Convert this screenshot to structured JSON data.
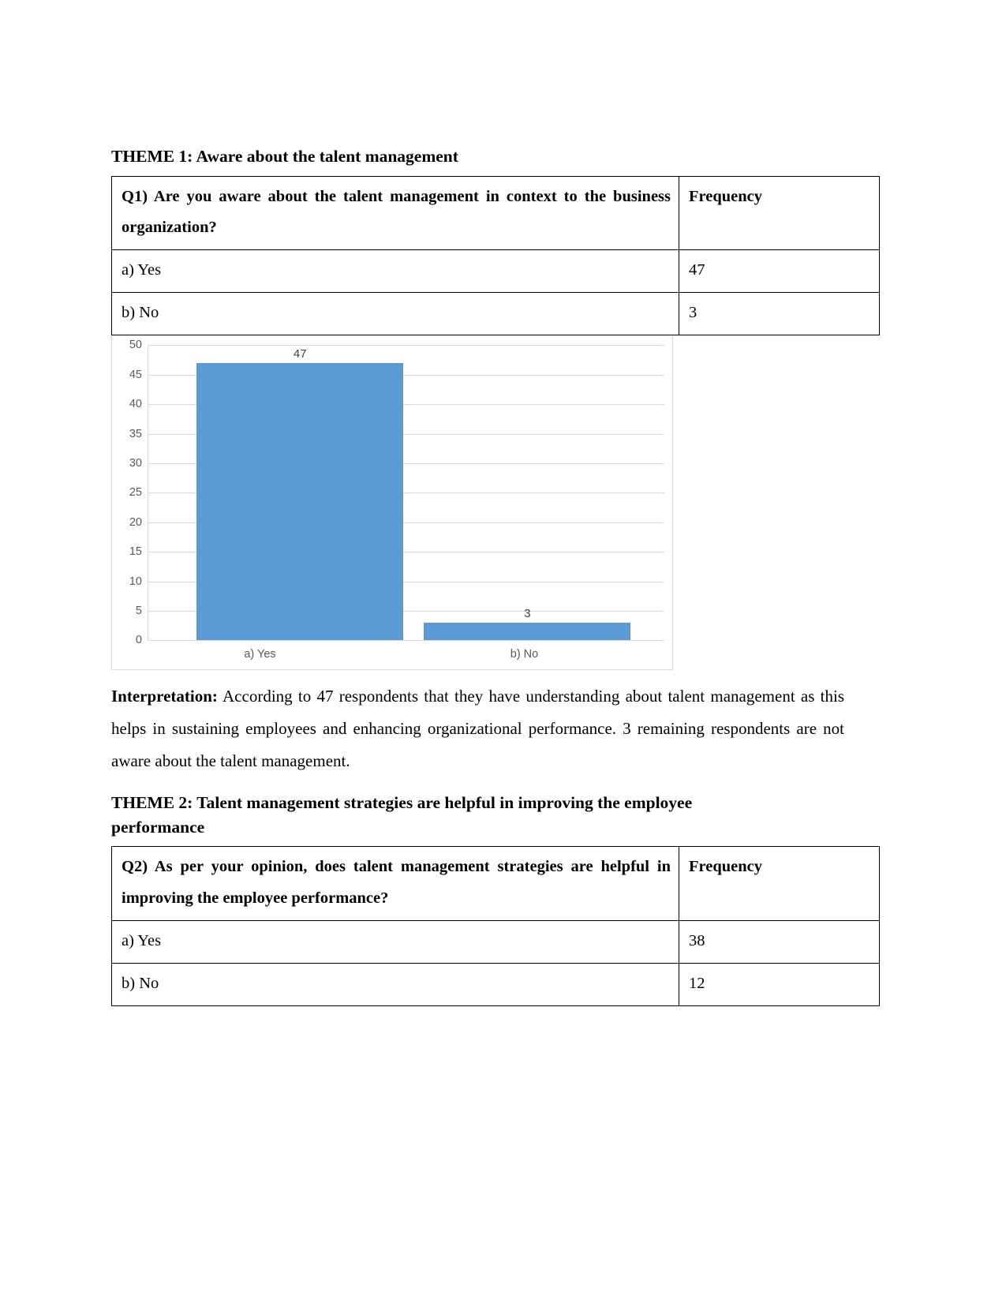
{
  "document": {
    "theme1_heading": "THEME 1: Aware about the talent management",
    "theme2_heading_line1": "THEME 2: Talent management strategies are helpful in improving the employee",
    "theme2_heading_line2": "performance",
    "interpretation_label": "Interpretation:",
    "interpretation_text": " According to 47 respondents that they have understanding about talent management as this helps in sustaining employees and enhancing organizational performance. 3 remaining respondents are not aware about the talent management."
  },
  "table1": {
    "question": "Q1) Are you aware about the talent management in context to the business organization?",
    "frequency_header": "Frequency",
    "rows": [
      {
        "option": "a) Yes",
        "frequency": "47"
      },
      {
        "option": "b) No",
        "frequency": "3"
      }
    ]
  },
  "table2": {
    "question": "Q2) As per your opinion, does talent management strategies are helpful in improving the employee performance?",
    "frequency_header": "Frequency",
    "rows": [
      {
        "option": "a) Yes",
        "frequency": "38"
      },
      {
        "option": "b) No",
        "frequency": "12"
      }
    ]
  },
  "chart_data": {
    "type": "bar",
    "title": "",
    "xlabel": "",
    "ylabel": "",
    "categories": [
      "a) Yes",
      "b) No"
    ],
    "values": [
      47,
      3
    ],
    "data_labels": [
      "47",
      "3"
    ],
    "ylim": [
      0,
      50
    ],
    "yticks": [
      0,
      5,
      10,
      15,
      20,
      25,
      30,
      35,
      40,
      45,
      50
    ],
    "ytick_labels": [
      "0",
      "5",
      "10",
      "15",
      "20",
      "25",
      "30",
      "35",
      "40",
      "45",
      "50"
    ],
    "grid": true,
    "legend": "none",
    "series": [
      {
        "name": "Frequency",
        "values": [
          47,
          3
        ]
      }
    ],
    "colors": {
      "bar": "#5b9bd5",
      "gridline": "#d9d9d9",
      "tick_text": "#595959",
      "label_text": "#404040"
    }
  }
}
